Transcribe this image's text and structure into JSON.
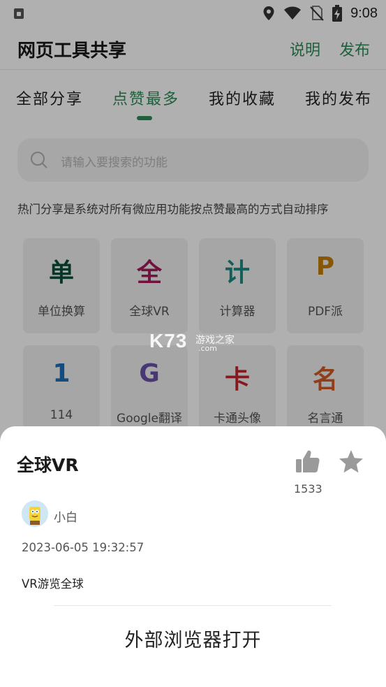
{
  "status_bar": {
    "time": "9:08",
    "icons": [
      "lock-icon",
      "location-icon",
      "wifi-icon",
      "no-sim-icon",
      "battery-charging-icon"
    ]
  },
  "app_bar": {
    "title": "网页工具共享",
    "help_label": "说明",
    "publish_label": "发布"
  },
  "tabs": [
    {
      "label": "全部分享",
      "active": false
    },
    {
      "label": "点赞最多",
      "active": true
    },
    {
      "label": "我的收藏",
      "active": false
    },
    {
      "label": "我的发布",
      "active": false
    }
  ],
  "search": {
    "placeholder": "请输入要搜索的功能"
  },
  "hint_text": "热门分享是系统对所有微应用功能按点赞最高的方式自动排序",
  "apps": [
    {
      "glyph": "单",
      "label": "单位换算",
      "color": "#0b4f3a"
    },
    {
      "glyph": "全",
      "label": "全球VR",
      "color": "#a3195b"
    },
    {
      "glyph": "计",
      "label": "计算器",
      "color": "#1a8a80"
    },
    {
      "glyph": "P",
      "label": "PDF派",
      "color": "#c77d0a"
    },
    {
      "glyph": "1",
      "label": "114",
      "color": "#1e6fb8"
    },
    {
      "glyph": "G",
      "label": "Google翻译",
      "color": "#6b4fa8"
    },
    {
      "glyph": "卡",
      "label": "卡通头像",
      "color": "#c0262f"
    },
    {
      "glyph": "名",
      "label": "名言通",
      "color": "#d05a26"
    }
  ],
  "watermark": {
    "brand": "K73",
    "text": "游戏之家",
    "suffix": ".com"
  },
  "detail_sheet": {
    "app_name": "全球VR",
    "like_count": "1533",
    "author": "小白",
    "timestamp": "2023-06-05 19:32:57",
    "description": "VR游览全球",
    "open_button": "外部浏览器打开"
  },
  "colors": {
    "accent": "#2e8b57",
    "overlay": "rgba(0,0,0,0.31)",
    "icon_gray": "#9a9a9a"
  }
}
